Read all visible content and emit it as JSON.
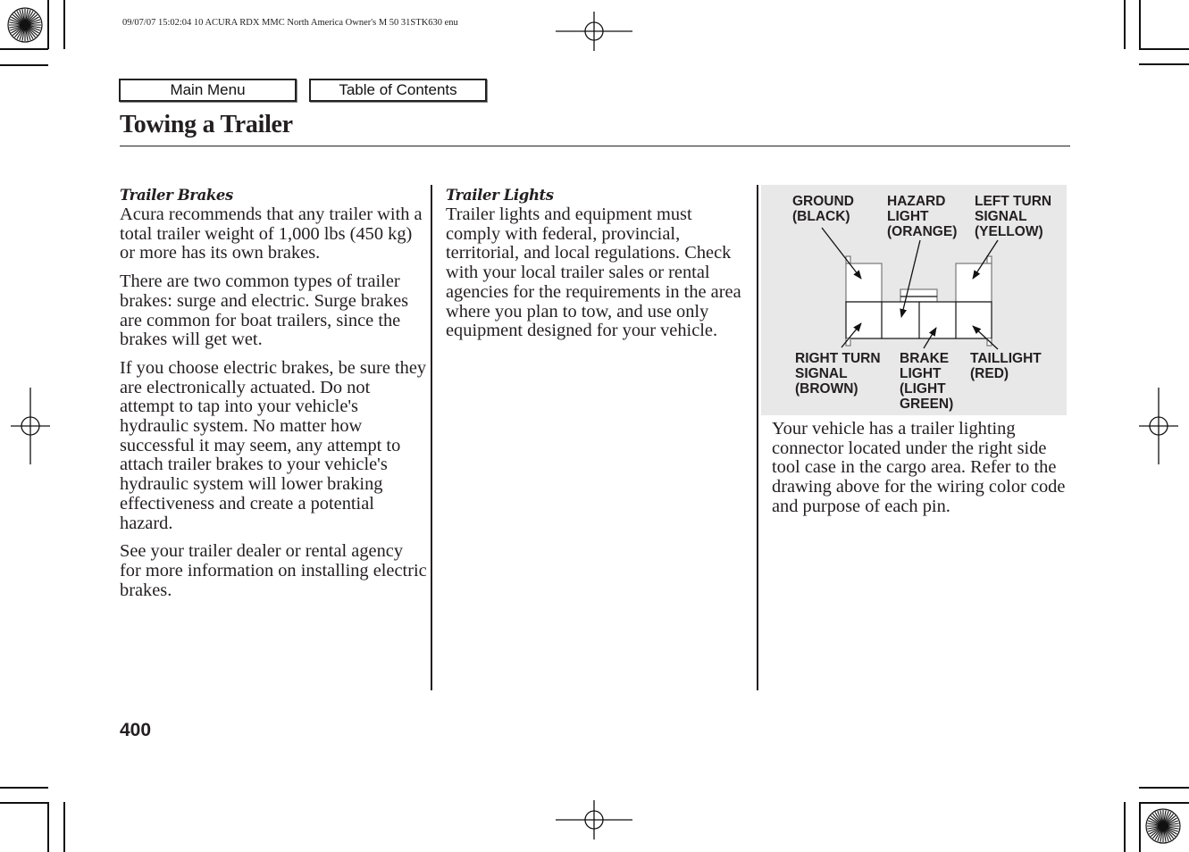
{
  "print_header": "09/07/07 15:02:04    10 ACURA RDX MMC North America Owner's M 50 31STK630 enu",
  "nav": {
    "main_menu_label": "Main Menu",
    "toc_label": "Table of Contents"
  },
  "page": {
    "title": "Towing a Trailer",
    "number": "400"
  },
  "sections": {
    "trailer_brakes": {
      "heading": "Trailer Brakes",
      "paragraphs": [
        "Acura recommends that any trailer with a total trailer weight of 1,000 lbs (450 kg) or more has its own brakes.",
        "There are two common types of trailer brakes: surge and electric. Surge brakes are common for boat trailers, since the brakes will get wet.",
        "If you choose electric brakes, be sure they are electronically actuated. Do not attempt to tap into your vehicle's hydraulic system. No matter how successful it may seem, any attempt to attach trailer brakes to your vehicle's hydraulic system will lower braking effectiveness and create a potential hazard.",
        "See your trailer dealer or rental agency for more information on installing electric brakes."
      ]
    },
    "trailer_lights": {
      "heading": "Trailer Lights",
      "paragraphs": [
        "Trailer lights and equipment must comply with federal, provincial, territorial, and local regulations. Check with your local trailer sales or rental agencies for the requirements in the area where you plan to tow, and use only equipment designed for your vehicle."
      ]
    },
    "connector_note": {
      "paragraphs": [
        "Your vehicle has a trailer lighting connector located under the right side tool case in the cargo area. Refer to the drawing above for the wiring color code and purpose of each pin."
      ]
    }
  },
  "diagram": {
    "background_color": "#e8e8e8",
    "labels": {
      "ground": "GROUND\n(BLACK)",
      "hazard": "HAZARD\nLIGHT\n(ORANGE)",
      "left_turn": "LEFT TURN\nSIGNAL\n(YELLOW)",
      "right_turn": "RIGHT TURN\nSIGNAL\n(BROWN)",
      "brake": "BRAKE\nLIGHT\n(LIGHT\nGREEN)",
      "taillight": "TAILLIGHT\n(RED)"
    }
  }
}
